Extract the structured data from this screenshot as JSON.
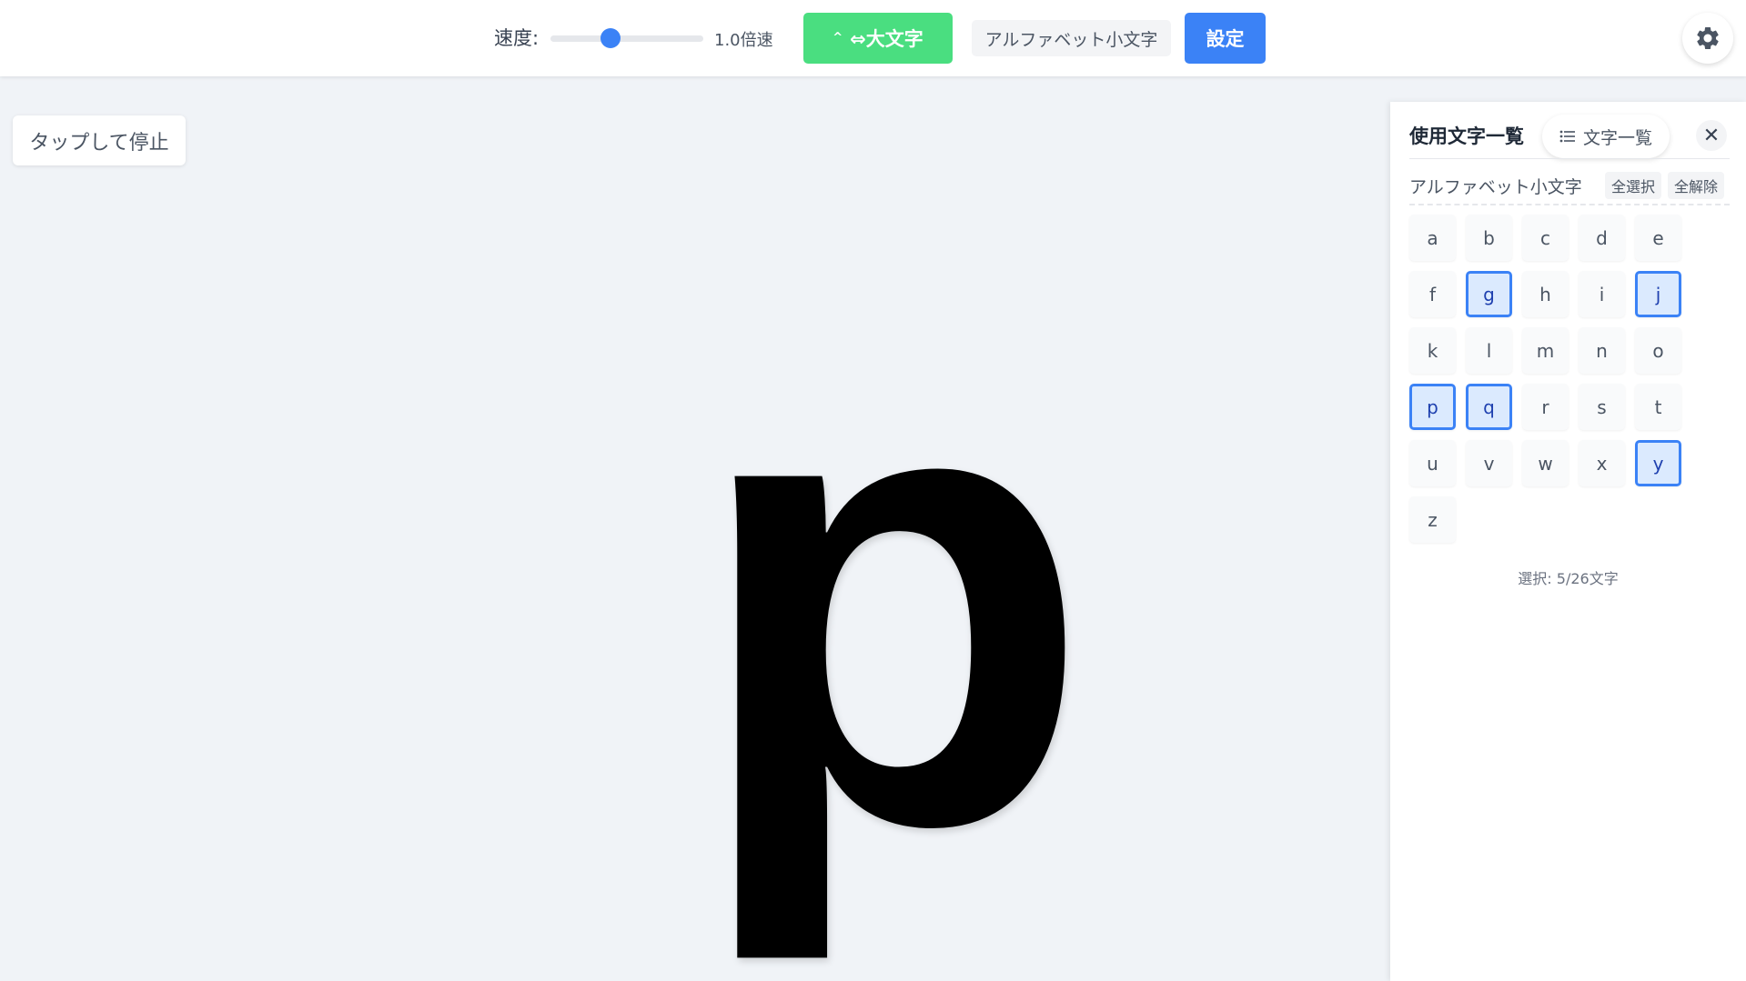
{
  "header": {
    "speed_label": "速度:",
    "speed_value": "1.0倍速",
    "speed_slider_fraction": 0.39,
    "case_toggle_label": "⇔大文字",
    "mode_label": "アルファベット小文字",
    "settings_label": "設定",
    "icons": {
      "case_toggle": "caret-up-icon",
      "settings": "gear-icon"
    }
  },
  "main": {
    "stop_label": "タップして停止",
    "current_letter": "p"
  },
  "panel": {
    "title": "使用文字一覧",
    "list_button_label": "文字一覧",
    "close_label": "✕",
    "group_label": "アルファベット小文字",
    "select_all_label": "全選択",
    "deselect_all_label": "全解除",
    "letters": [
      {
        "char": "a",
        "selected": false
      },
      {
        "char": "b",
        "selected": false
      },
      {
        "char": "c",
        "selected": false
      },
      {
        "char": "d",
        "selected": false
      },
      {
        "char": "e",
        "selected": false
      },
      {
        "char": "f",
        "selected": false
      },
      {
        "char": "g",
        "selected": true
      },
      {
        "char": "h",
        "selected": false
      },
      {
        "char": "i",
        "selected": false
      },
      {
        "char": "j",
        "selected": true
      },
      {
        "char": "k",
        "selected": false
      },
      {
        "char": "l",
        "selected": false
      },
      {
        "char": "m",
        "selected": false
      },
      {
        "char": "n",
        "selected": false
      },
      {
        "char": "o",
        "selected": false
      },
      {
        "char": "p",
        "selected": true
      },
      {
        "char": "q",
        "selected": true
      },
      {
        "char": "r",
        "selected": false
      },
      {
        "char": "s",
        "selected": false
      },
      {
        "char": "t",
        "selected": false
      },
      {
        "char": "u",
        "selected": false
      },
      {
        "char": "v",
        "selected": false
      },
      {
        "char": "w",
        "selected": false
      },
      {
        "char": "x",
        "selected": false
      },
      {
        "char": "y",
        "selected": true
      },
      {
        "char": "z",
        "selected": false
      }
    ],
    "selection_count": "選択: 5/26文字"
  },
  "colors": {
    "accent_blue": "#3b82f6",
    "toggle_green": "#4ade80",
    "selected_fill": "#dbeafe",
    "background": "#f0f3f7"
  }
}
